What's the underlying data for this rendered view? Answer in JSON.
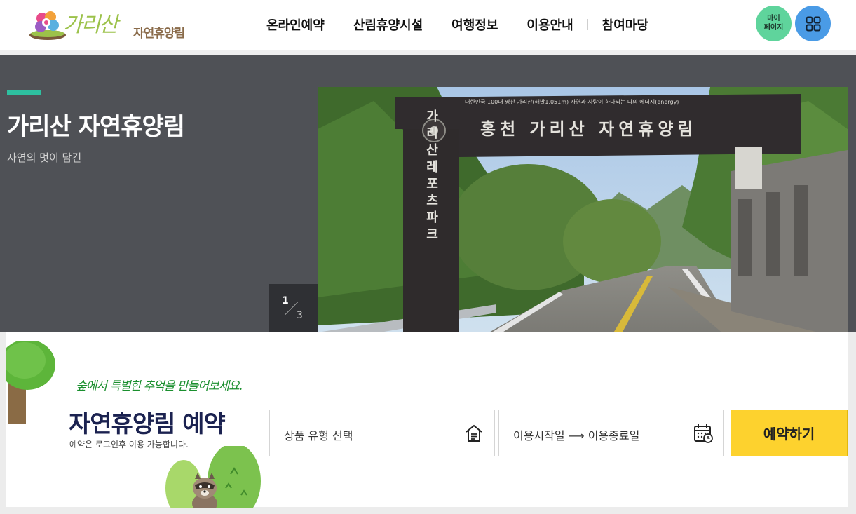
{
  "header": {
    "logo_script": "가리산",
    "logo_sub": "자연휴양림",
    "nav": [
      {
        "label": "온라인예약"
      },
      {
        "label": "산림휴양시설"
      },
      {
        "label": "여행정보"
      },
      {
        "label": "이용안내"
      },
      {
        "label": "참여마당"
      }
    ],
    "mypage_line1": "마이",
    "mypage_line2": "페이지"
  },
  "hero": {
    "title": "가리산 자연휴양림",
    "subtitle": "자연의 멋이 담긴",
    "slide_current": "1",
    "slide_total": "3",
    "gate_text": "홍천 가리산 자연휴양림",
    "gate_pillar": "가리산레포츠파크",
    "gate_top_small": "대한민국 100대 명산 가리산(해발1,051m) 자연과 사람이 하나되는 나의 에너지(energy)"
  },
  "reservation": {
    "script_text": "숲에서 특별한 추억을 만들어보세요.",
    "title": "자연휴양림 예약",
    "note": "예약은 로그인후 이용 가능합니다.",
    "type_placeholder": "상품 유형 선택",
    "date_placeholder": "이용시작일 ⟶ 이용종료일",
    "submit_label": "예약하기"
  },
  "colors": {
    "hero_bg": "#4f5156",
    "accent": "#2ec0a0",
    "mypage": "#5fd49c",
    "allmenu": "#4a9be6",
    "book_button": "#fdd22e",
    "title_navy": "#1b2250"
  }
}
